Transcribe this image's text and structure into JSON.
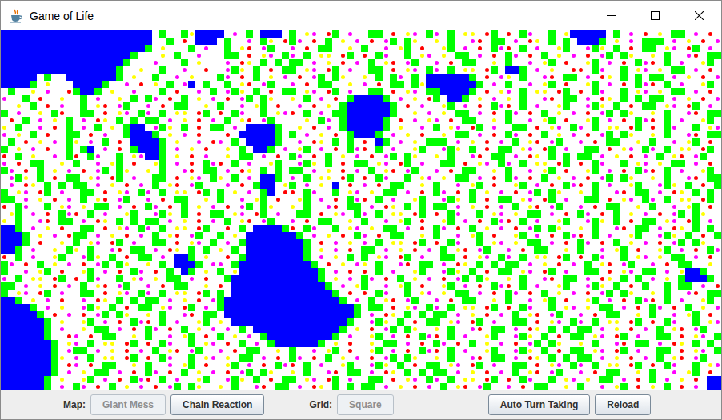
{
  "window": {
    "title": "Game of Life"
  },
  "board": {
    "legend": [
      {
        "code": ".",
        "kind": "fill",
        "color": "#ffffff"
      },
      {
        "code": "g",
        "kind": "fill",
        "color": "#00ff00"
      },
      {
        "code": "b",
        "kind": "fill",
        "color": "#0000ff"
      },
      {
        "code": "y",
        "kind": "dot",
        "color": "#ffff00"
      },
      {
        "code": "r",
        "kind": "dot",
        "color": "#ff0000"
      },
      {
        "code": "m",
        "kind": "dot",
        "color": "#ff00ff"
      }
    ],
    "rows": [
      [
        "bbbbbbbbbb",
        "bbbbbbbbbb",
        "b.g..gybbb",
        "b.m.g.bbb.",
        "g.ym.rg.m.",
        ".gg.r.ym.g",
        "m.g.yy.rg.",
        "r.gm..g.yb",
        "bbbb.g.m.r",
        ".y.gg.m.r."
      ],
      [
        "bbbbbbbbbb",
        "bbbbbbbbbb",
        "b..g.r.bbb",
        ".g..m.gy.r",
        "gm.r.g.y.m",
        ".r.mg.gy..",
        "y.g..mr.gg",
        ".m.ry.g.g.",
        "bbbg.y.m.g",
        "gg.m.y.r.m"
      ],
      [
        "bbbbbbbbbb",
        "bbbbbbbbbb",
        "g.y...g.m.",
        ".g.yr.mg..",
        "m.r.gg..y.",
        "g..m.yg.r.",
        ".yg.m.r.gm",
        "r.g.m..yg.",
        ".mgy.g.r.g",
        "g.ym.rg.m."
      ],
      [
        "bbbbbbbbbb",
        "bbbbbbbbg.",
        "..y.g..m..",
        ".gg.r.ym.g",
        "m.g.yy.rg.",
        "r.gm..g.ym",
        ".y.gg.m.r.",
        "gm.r.g.y.m",
        ".r.mg.gy..",
        "y.g..mr.gg"
      ],
      [
        "bbbbbbbbbb",
        "bbbbbbbg..",
        ".m...g.y..",
        ".m.ry.g.g.",
        "gg.m.y.r.m",
        ".g.yr.mg..",
        "m.r.gg..y.",
        "g..m.yg.r.",
        ".yg.m.r.gm",
        "r.g.m..yg."
      ],
      [
        "bbbbbbbbbb",
        "bbbbbbg..y",
        "..g..m..r.",
        ".mgy.g.r.g",
        "g.ym.rg.m.",
        ".gg.r.ym.g",
        "m.g.yy.rg.",
        "bbg.m.y..r",
        "r.gm..g.ym",
        ".y.gg.m.r."
      ],
      [
        "bbbbb.g..b",
        "bbbbbbg.y.",
        ".g..m.y...",
        "gm.r.g.y.m",
        ".r.mg.gy..",
        "y.g.gm.g.b",
        "bbbbbg.r.m",
        "y.g..mr.gg",
        ".m.ry.g.g.",
        "gg.m.y.r.m"
      ],
      [
        "bbbbg.y...",
        "bbbbg..m.r",
        ".y.g.mb.g.",
        ".g.yr.mg..",
        "m.r.gg..y.",
        "m.r.gg.gyb",
        "bbbbbbg.m.",
        "g..m.yg.r.",
        ".yg.m.r.gm",
        "r.g.m..yg."
      ],
      [
        ".g..y.m..r",
        "gbbg.y..m.",
        "..g.r..m.g",
        ".mgy.g.r.g",
        "g.ym.rg.m.",
        ".gg.r.ym.g",
        "gbbbbg.r.y",
        "m.g.yy.rg.",
        "r.gm..g.ym",
        ".y.gg.m.r."
      ],
      [
        "m..g.r..y.",
        ".g.m..y.g.",
        "gm.r.g.y.m",
        ".r.mg.gy..",
        "y.g.m.r.gb",
        "bbbg.m.y.r",
        "g.bbg.y.m.",
        "y.g..mr.gg",
        ".m.ry.g.g.",
        "gg.m.y.r.m"
      ],
      [
        "..y.g.r.m.",
        ".g.yr.mg..",
        "m.r.gg..y.",
        "g..m.yg.r.",
        ".m.r.y.gbb",
        "bbbbg.r.m.",
        ".yg.m.r.gm",
        "r.g.m..yg.",
        ".mgy.g.r.g",
        "g.ym.rg.m."
      ],
      [
        "g.m..y.gr.",
        ".gg.r.ym.g",
        "m.g.yy.rg.",
        "r.gm..g.ym",
        "r.g.m.ggbb",
        "bbbbg..y.m",
        ".y.gg.m.r.",
        "gm.r.g.y.m",
        ".r.mg.gy..",
        "y.g..mr.gg"
      ],
      [
        ".r.g.m.y.g",
        ".m.ry.g.g.",
        "gg.m.y.r.m",
        ".g.yr.mg..",
        "..y.gm.gbb",
        "bbbg.r.m.y",
        "m.r.gg..y.",
        "g..m.yg.r.",
        ".yg.m.r.gm",
        "r.g.m..yg."
      ],
      [
        "y.g..m.r.g",
        ".m.g.y.gbb",
        ".mgy.g.r.g",
        "g.m.bbbbg.",
        ".y.r.m.gbb",
        "bbbg.y..m.",
        "g.ym.rg.m.",
        ".gg.r.ym.g",
        "m.g.yy.rg.",
        "r.gm..g.ym"
      ],
      [
        "m.y.g.r..g",
        "g.r.m..gbb",
        "bg.y.m.r..",
        ".r.bbbbbg.",
        "g.m.y.r.gb",
        "bbg.m.y.r.",
        ".y.gg.m.r.",
        "gm.r.g.y.m",
        ".r.mg.gy..",
        "y.g..mr.gg"
      ],
      [
        ".g.r.y.m.g",
        "y.m.g.r.bb",
        "bbg.y..m.r",
        "m.g.bbbbg.",
        ".m.ry.g.g.",
        "r.bg.m.y.g",
        "gg.m.y.r.m",
        ".g.yr.mg..",
        "m.r.gg..y.",
        "g..m.yg.r."
      ],
      [
        "g.y.m.r..g",
        ".gb.m.r.gb",
        "bbg.m.y.r.",
        ".y.g.bbg.m",
        ".yg.m.r.gm",
        "r.g.m..yg.",
        ".mgy.g.r.g",
        "g.ym.rg.m.",
        ".gg.r.ym.g",
        "m.g.yy.rg."
      ],
      [
        "r.g.y..m.g",
        "r.gm..g.ym",
        "bbg.y.r.m.",
        ".y.gg.m.r.",
        "gm.r.g.y.m",
        ".r.mg.gy..",
        "y.g..mr.gg",
        ".m.ry.g.g.",
        "gg.m.y.r.m",
        ".g.yr.mg.."
      ],
      [
        "m.r.gg..y.",
        "g..m.yg.r.",
        ".yg.m.r.gm",
        "r.g.m..yg.",
        ".mgy.g.r.g",
        "g.ym.rg.m.",
        ".gg.r.ym.g",
        "m.g.yy.rg.",
        "r.gm..g.ym",
        ".y.gg.m.r."
      ],
      [
        "gm.r.g.y.m",
        ".r.mg.gy..",
        "y.g..mr.gg",
        ".m.ry.g.g.",
        "gg.m.y.r.m",
        ".g.yr.mg..",
        "m.r.gg..y.",
        "g..m.yg.r.",
        ".yg.m.r.gm",
        "r.g.m..yg."
      ],
      [
        ".mgy.g.r.g",
        "g.ym.rg.m.",
        ".gg.r.ym.g",
        "y.g.m.bbg.",
        "m.g.yy.rg.",
        "r.gm..g.ym",
        ".y.gg.m.r.",
        "gm.r.g.y.m",
        ".r.mg.gy..",
        "y.g..mr.gg"
      ],
      [
        ".m.ry.g.g.",
        "gg.m.y.r.m",
        ".g.yr.mg..",
        ".m.r.gbb.y",
        "g.m.y.b.r.",
        "m.r.gg..y.",
        "g..m.yg.r.",
        ".yg.m.r.gm",
        "r.g.m..yg.",
        ".mgy.g.r.g"
      ],
      [
        "g.ym.rg.m.",
        ".gg.r.ym.g",
        "m.g.yy.rg.",
        "g.y.m.gb.r",
        "r.gm..g.ym",
        ".y.gg.m.r.",
        "gm.r.g.y.m",
        ".r.mg.gy..",
        "y.g..mr.gg",
        ".m.ry.g.g."
      ],
      [
        "gg.m.y.r.m",
        ".g.yr.mg..",
        "m.r.gg..y.",
        "g..m.yg.r.",
        ".yg.m.r.gm",
        "r.g.m..yg.",
        ".mgy.g.r.g",
        "g.ym.rg.m.",
        ".gg.r.ym.g",
        "m.g.yy.rg."
      ],
      [
        "r.gm..g.ym",
        ".y.gg.m.r.",
        "gm.r.g.y.m",
        ".r.mg.gy..",
        "y.g..mr.gg",
        ".m.ry.g.g.",
        "gg.m.y.r.m",
        ".g.yr.mg..",
        "m.r.gg..y.",
        "g..m.yg.r."
      ],
      [
        ".yg.m.r.gm",
        "r.g.m..yg.",
        ".mgy.g.r.g",
        "g.ym.rg.m.",
        ".gg.r.ym.g",
        "m.g.yy.rg.",
        "r.gm..g.ym",
        ".y.gg.m.r.",
        "gm.r.g.y.m",
        ".r.mg.gy.."
      ],
      [
        "y.g..mr.gg",
        ".m.ry.g.g.",
        "gg.m.y.r.m",
        ".g.yr.mg..",
        "m.r.gg..y.",
        "g..m.yg.r.",
        ".yg.m.r.gm",
        "r.g.m..yg.",
        ".mgy.g.r.g",
        "g.ym.rg.m."
      ],
      [
        "bbg.m.y.r.",
        ".gg.r.ym.g",
        "m.g.yy.rg.",
        ".r.g.bbbbg",
        "r.gm..g.ym",
        ".y.gg.m.r.",
        "gm.r.g.y.m",
        ".r.mg.gy..",
        "y.g..mr.gg",
        ".m.ry.g.g."
      ],
      [
        "bbbg.y.m.r",
        "gg.m.y.r.m",
        ".g.yr.mg..",
        "g.y.bbbbbb",
        "bg.m.y.r.g",
        "m.r.gg..y.",
        "g..m.yg.r.",
        ".yg.m.r.gm",
        "r.g.m..yg.",
        ".mgy.g.r.g"
      ],
      [
        "bbbg.r..y.",
        "g.ym.rg.m.",
        ".gg.r.ym.g",
        ".m.gbbbbbb",
        "bbg.r.m.y.",
        "m.g.yy.rg.",
        "r.gm..g.ym",
        ".y.gg.m.r.",
        "gm.r.g.y.m",
        ".r.mg.gy.."
      ],
      [
        "bbg.m..y.g",
        "y.g..mr.gg",
        ".m.ry.g.g.",
        "y.g.bbbbbb",
        "bbg.y.m.r.",
        "gg.m.y.r.m",
        ".g.yr.mg..",
        "m.r.gg..y.",
        "g..m.yg.r.",
        ".yg.m.r.gm"
      ],
      [
        "r.g.m..yg.",
        ".mgy.g.r.g",
        "g.m.bbg.y.",
        ".r.gbbbbbb",
        "bbg.m.y.g.",
        "g.ym.rg.m.",
        ".gg.r.ym.g",
        "m.g.yy.rg.",
        "r.gm..g.ym",
        ".y.gg.m.r."
      ],
      [
        "gm.r.g.y.m",
        ".r.mg.gy..",
        "y.g.bbbg.m",
        "m.gbbbbbbb",
        "bbbg.r.y.m",
        "y.g..mr.gg",
        ".m.ry.g.g.",
        "gg.m.y.r.m",
        ".g.yr.mg..",
        "m.r.gg..y."
      ],
      [
        "g..m.yg.r.",
        ".yg.m.r.gm",
        ".r.g.bg.y.",
        "g.ybbbbbbb",
        "bbbbg.m.r.",
        "r.g.m..yg.",
        ".mgy.g.r.g",
        "g.ym.rg.m.",
        ".gg.r.ym.g",
        "g.m.ybbg.."
      ],
      [
        "m.g.yy.rg.",
        "r.gm..g.ym",
        ".y.gg.m.r.",
        ".gbbbbbbbb",
        "bbbbg.y.m.",
        "gm.r.g.y.m",
        ".r.mg.gy..",
        "y.g..mr.gg",
        ".m.ry.g.g.",
        "m.y.gbbbg."
      ],
      [
        "gg.m.y.r.m",
        ".g.yr.mg..",
        "m.r.gg..y.",
        "r.bbbbbbbb",
        "bbbbbg.m.y",
        "g..m.yg.r.",
        ".yg.m.r.gm",
        "r.g.m..yg.",
        ".mgy.g.r.g",
        "..g.gg.m.r"
      ],
      [
        "g.ym.rg.m.",
        ".gg.r.ym.g",
        "m.g.yy.rg.",
        "g.bbbbbbbb",
        "bbbbbbg.r.",
        "r.gm..g.ym",
        ".y.gg.m.r.",
        "gm.r.g.y.m",
        ".r.mg.gy..",
        "y.g..mr.gg"
      ],
      [
        "bbg.y.m.r.",
        ".m.ry.g.g.",
        "gg.m.y.r.m",
        "gbbbbbbbbb",
        "bbbbbbbg.m",
        ".g.yr.mg..",
        "m.r.gg..y.",
        "g..m.yg.r.",
        ".yg.m.r.gm",
        "r.g.m..yg."
      ],
      [
        "bbbbg.m.y.",
        ".mgy.g.r.g",
        "g.ym.rg.m.",
        "gbbbbbbbbb",
        "bbbbbbbbbg",
        ".gg.r.ym.g",
        "m.g.yy.rg.",
        "r.gm..g.ym",
        ".y.gg.m.r.",
        "gm.r.g.y.m"
      ],
      [
        "bbbbbg.r.m",
        ".r.mg.gy..",
        "y.g..mr.gg",
        ".bbbbbbbbb",
        "bbbbbbbbbg",
        ".m.ry.g.g.",
        "gg.m.y.r.m",
        ".g.yr.mg..",
        "m.r.gg..y.",
        "g..m.yg.r."
      ],
      [
        "bbbbbbg.y.",
        ".yg.m.r.gm",
        "r.g.m..yg.",
        "y.bbbbbbbb",
        "bbbbbbbbg.",
        ".mgy.g.r.g",
        "g.ym.rg.m.",
        ".gg.r.ym.g",
        "m.g.yy.rg.",
        "r.gm..g.ym"
      ],
      [
        "bbbbbbg.m.",
        ".y.gg.m.r.",
        "gm.r.g.y.m",
        ".m.g.bbbbb",
        "bbbbbbbg.y",
        ".r.mg.gy..",
        "y.g..mr.gg",
        ".m.ry.g.g.",
        "gg.m.y.r.m",
        ".g.yr.mg.."
      ],
      [
        "bbbbbbg..r",
        "m.r.gg..y.",
        "g..m.yg.r.",
        "g.y.m.gbbb",
        "bbbbbbg.m.",
        ".yg.m.r.gm",
        "r.g.m..yg.",
        ".mgy.g.r.g",
        "g.ym.rg.m.",
        ".gg.r.ym.g"
      ],
      [
        "bbbbbbbg.y",
        "m.g.yy.rg.",
        "r.gm..g.ym",
        ".r.g.m.gbb",
        "bbbbg.y.r.",
        ".y.gg.m.r.",
        "gm.r.g.y.m",
        ".r.mg.gy..",
        "y.g..mr.gg",
        ".m.ry.g.g."
      ],
      [
        "bbbbbbbg.m",
        "gg.m.y.r.m",
        ".g.yr.mg..",
        "m.r.gg..y.",
        "g..m.yg.r.",
        ".yg.m.r.gm",
        "r.g.m..yg.",
        ".mgy.g.r.g",
        "g.ym.rg.m.",
        ".gg.r.ym.g"
      ],
      [
        "bbbbbbbgy.",
        "m.g.yy.rg.",
        "r.gm..g.ym",
        ".y.gg.m.r.",
        "gm.r.g.y.m",
        ".r.mg.gy..",
        "y.g..mr.gg",
        ".m.ry.g.g.",
        "gg.m.y.r.m",
        ".g.yr.mg.."
      ],
      [
        "bbbbbbbg.r",
        "m.r.gg..y.",
        "g..m.yg.r.",
        ".yg.m.r.gm",
        "r.g.m..yg.",
        ".mgy.g.r.g",
        "g.ym.rg.m.",
        ".gg.r.ym.g",
        "m.g.yy.rg.",
        "r.gm..g.ym"
      ],
      [
        "bbbbbbbg.m",
        ".y.gg.m.r.",
        "gm.r.g.y.m",
        ".r.mg.gy..",
        "y.g..mr.gg",
        ".m.ry.g.g.",
        "gg.m.y.r.m",
        ".g.yr.mg..",
        "m.r.gg..y.",
        "g..m.yg.r."
      ],
      [
        "bbbbbbg.y.",
        ".yg.m.r.gm",
        "r.g.m..yg.",
        ".mgy.g.r.g",
        "g.ym.rg.m.",
        ".gg.r.ym.g",
        "m.g.yy.rg.",
        "r.gm..g.ym",
        ".y.gg.m.r.",
        "g.m.y.r.bb"
      ],
      [
        "bbbbbbg.m.",
        "gm.r.g.y.m",
        ".r.mg.gy..",
        "y.g..mr.gg",
        ".m.ry.g.g.",
        "gg.m.y.r.m",
        ".g.yr.mg..",
        "m.r.gg..y.",
        "g..m.yg.r.",
        "y.g.r.m.bb"
      ]
    ]
  },
  "toolbar": {
    "groups": [
      {
        "label": "Map:",
        "buttons": [
          {
            "label": "Giant Mess",
            "disabled": true
          },
          {
            "label": "Chain Reaction",
            "disabled": false
          }
        ]
      },
      {
        "label": "Grid:",
        "buttons": [
          {
            "label": "Square",
            "disabled": true
          }
        ]
      }
    ],
    "actions": [
      {
        "label": "Auto Turn Taking",
        "disabled": false
      },
      {
        "label": "Reload",
        "disabled": false
      }
    ]
  }
}
